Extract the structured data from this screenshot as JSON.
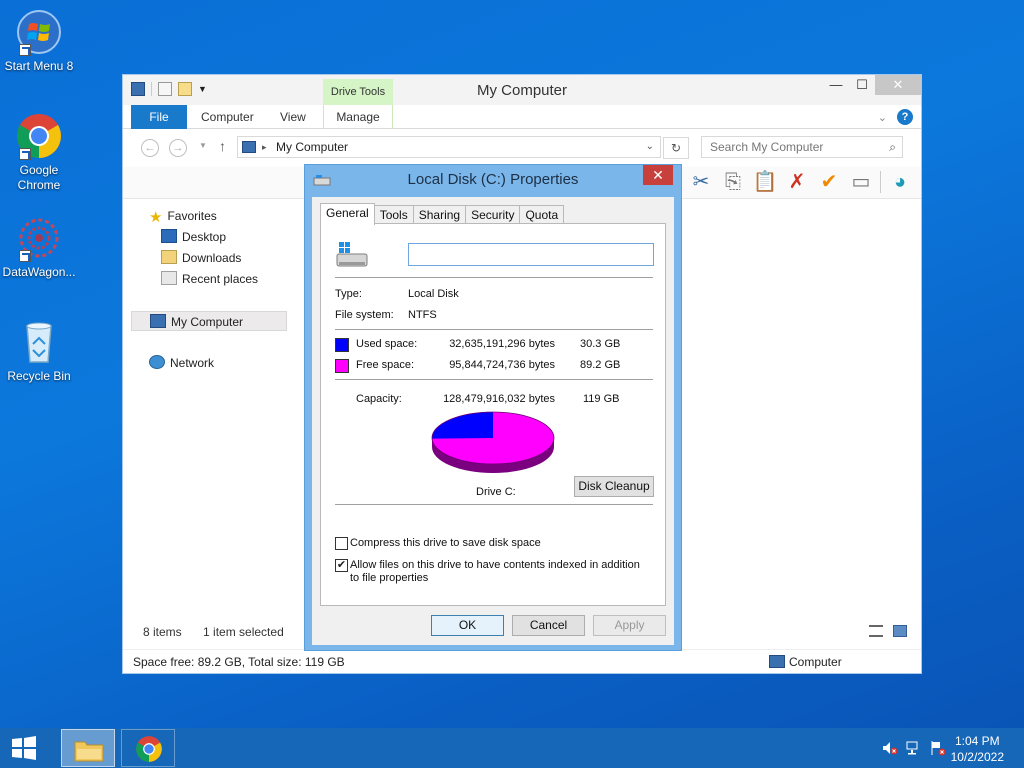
{
  "desktop": {
    "icons": [
      {
        "label": "Start Menu 8"
      },
      {
        "label": "Google Chrome"
      },
      {
        "label": "DataWagon..."
      },
      {
        "label": "Recycle Bin"
      }
    ]
  },
  "explorer": {
    "title": "My Computer",
    "contextual_tab_group": "Drive Tools",
    "tabs": [
      "File",
      "Computer",
      "View",
      "Manage"
    ],
    "address": "My Computer",
    "search_placeholder": "Search My Computer",
    "nav": {
      "favorites": "Favorites",
      "favorites_items": [
        "Desktop",
        "Downloads",
        "Recent places"
      ],
      "my_computer": "My Computer",
      "network": "Network"
    },
    "items_count": "8 items",
    "selection": "1 item selected",
    "status_left": "Space free: 89.2 GB, Total size: 119 GB",
    "status_right": "Computer"
  },
  "dialog": {
    "title": "Local Disk (C:) Properties",
    "tabs": [
      "General",
      "Tools",
      "Sharing",
      "Security",
      "Quota"
    ],
    "drive_name_value": "",
    "type_label": "Type:",
    "type_value": "Local Disk",
    "fs_label": "File system:",
    "fs_value": "NTFS",
    "used_label": "Used space:",
    "used_bytes": "32,635,191,296 bytes",
    "used_gb": "30.3 GB",
    "free_label": "Free space:",
    "free_bytes": "95,844,724,736 bytes",
    "free_gb": "89.2 GB",
    "capacity_label": "Capacity:",
    "capacity_bytes": "128,479,916,032 bytes",
    "capacity_gb": "119 GB",
    "drive_label": "Drive C:",
    "used_fraction": 0.254,
    "colors": {
      "used": "#0000ff",
      "free": "#ff00ff"
    },
    "disk_cleanup": "Disk Cleanup",
    "compress_label": "Compress this drive to save disk space",
    "compress_checked": false,
    "index_label": "Allow files on this drive to have contents indexed in addition to file properties",
    "index_checked": true,
    "ok": "OK",
    "cancel": "Cancel",
    "apply": "Apply"
  },
  "taskbar": {
    "time": "1:04 PM",
    "date": "10/2/2022"
  }
}
